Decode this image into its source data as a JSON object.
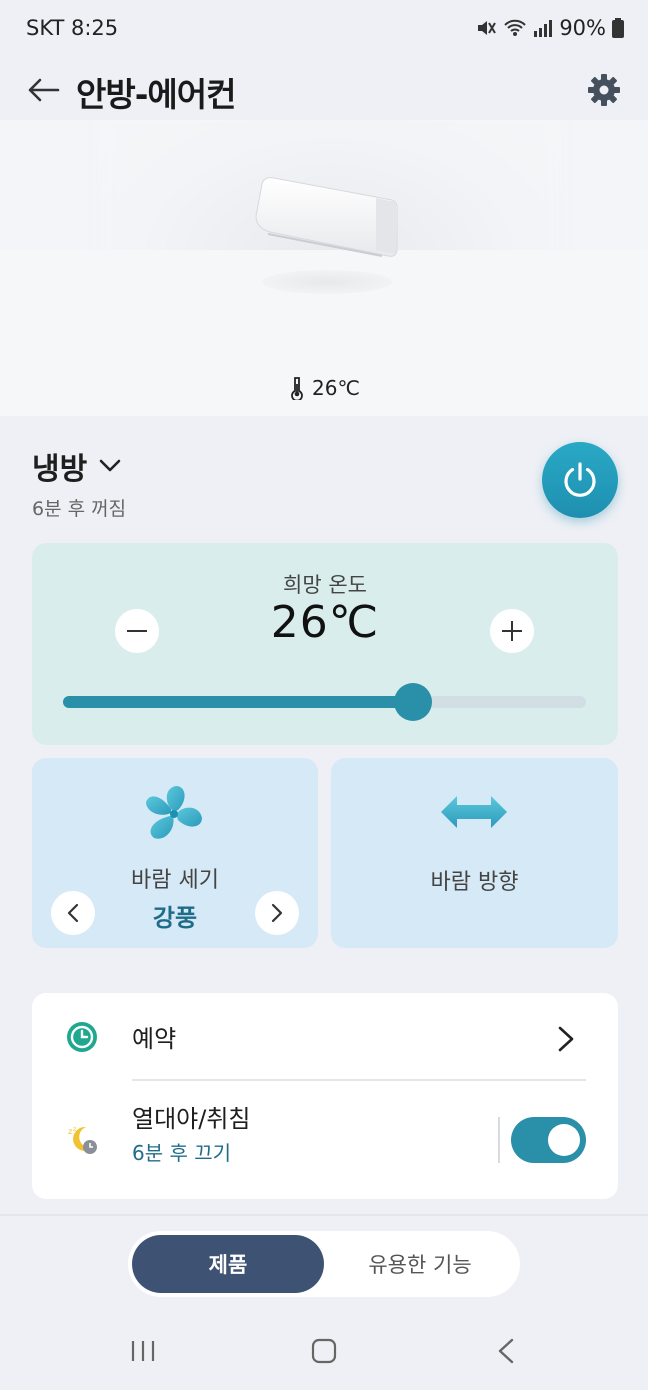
{
  "status_bar": {
    "carrier_time": "SKT 8:25",
    "battery": "90%"
  },
  "header": {
    "title": "안방-에어컨"
  },
  "hero": {
    "current_temperature": "26℃"
  },
  "mode": {
    "label": "냉방",
    "timer_text": "6분 후 꺼짐"
  },
  "temperature": {
    "label": "희망 온도",
    "value": "26℃",
    "slider_level_percent": 67
  },
  "wind_strength": {
    "label": "바람 세기",
    "value": "강풍"
  },
  "wind_direction": {
    "label": "바람 방향"
  },
  "options": {
    "reservation_label": "예약",
    "sleep_label": "열대야/취침",
    "sleep_sub": "6분 후 끄기",
    "sleep_enabled": true
  },
  "tabs": {
    "products": "제품",
    "useful": "유용한 기능",
    "active": "products"
  },
  "colors": {
    "accent": "#2a8fa8",
    "temp_card": "#d9eeec",
    "wind_card": "#d6e9f6",
    "tab_active": "#3e5273"
  },
  "icons": {
    "back": "arrow-left-icon",
    "settings": "gear-icon",
    "thermometer": "thermometer-icon",
    "power": "power-icon",
    "fan": "fan-icon",
    "wind_direction": "double-arrow-icon",
    "reservation": "clock-icon",
    "sleep": "moon-sleep-icon"
  }
}
